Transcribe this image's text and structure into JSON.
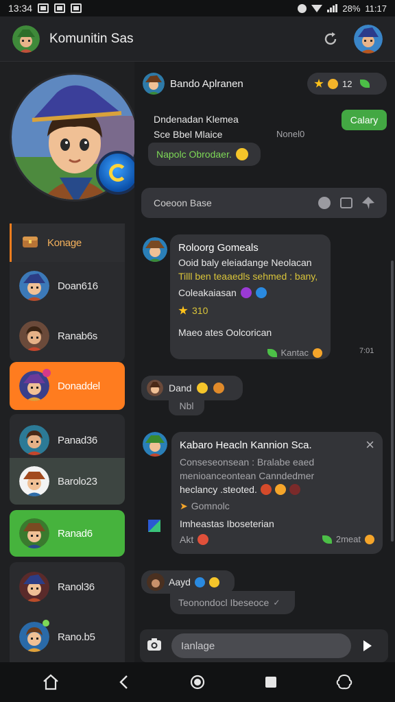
{
  "status_bar": {
    "time": "13:34",
    "battery": "28%",
    "clock_right": "11:17"
  },
  "header": {
    "title": "Komunitin Sas"
  },
  "sidebar": {
    "items": [
      {
        "label": "Konage"
      },
      {
        "label": "Doan616"
      },
      {
        "label": "Ranab6s"
      },
      {
        "label": "Donaddel"
      },
      {
        "label": "Panad36"
      },
      {
        "label": "Barolo23"
      },
      {
        "label": "Ranad6"
      },
      {
        "label": "Ranol36"
      },
      {
        "label": "Rano.b5"
      }
    ]
  },
  "chat": {
    "msg1": {
      "sender": "Bando Aplranen",
      "reaction_count": "12",
      "line1": "Dndenadan Klemea",
      "line2": "Sce Bbel Mlaice",
      "note": "Nonel0",
      "button": "Calary",
      "reply": "Napolc Obrodaer."
    },
    "search": {
      "placeholder": "Coeoon Base"
    },
    "msg2": {
      "title": "Roloorg Gomeals",
      "line1": "Ooid baly eleiadange Neolacan",
      "line2": "Tilll ben teaaedls sehmed : bany,",
      "line3": "Coleakaiasan",
      "stars": "310",
      "line4": "Maeo ates Oolcorican",
      "footer": "Kantac",
      "time": "7:01"
    },
    "msg3": {
      "line1": "Dand",
      "line2": "Nbl"
    },
    "msg4": {
      "title": "Kabaro Heacln Kannion Sca.",
      "line1": "Conseseonsean : Bralabe eaed",
      "line2": "menioanceontean Canndedmer",
      "line3": "heclancy .steoted.",
      "line4": "Gomnolc",
      "line5": "Imheastas Iboseterian",
      "line6": "Akt",
      "footer": "2meat"
    },
    "msg5": {
      "line1": "Aayd",
      "line2": "Teonondocl Ibeseoce"
    }
  },
  "composer": {
    "placeholder": "Ianlage"
  },
  "colors": {
    "accent_orange": "#ff7c1f",
    "accent_green": "#46b33d",
    "bg": "#1b1c1e"
  }
}
